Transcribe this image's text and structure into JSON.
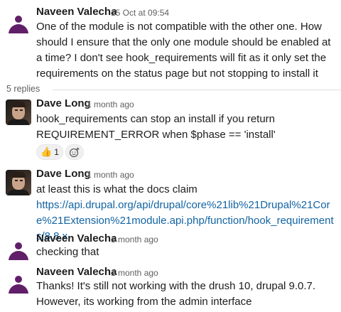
{
  "thread": {
    "replies_label": "5 replies",
    "messages": [
      {
        "author": "Naveen Valecha",
        "time": "15 Oct at 09:54",
        "text": "One of the module is not compatible with the other one. How should I ensure that the only one module should be enabled at a time? I don't see hook_requirements will fit as it only set the requirements on the status page but not stopping to install it"
      },
      {
        "author": "Dave Long",
        "time": "1 month ago",
        "text": "hook_requirements can stop an install if you return REQUIREMENT_ERROR when $phase == 'install'",
        "reaction": {
          "emoji": "👍",
          "count": "1"
        }
      },
      {
        "author": "Dave Long",
        "time": "1 month ago",
        "text_prefix": "at least this is what the docs claim",
        "link": "https://api.drupal.org/api/drupal/core%21lib%21Drupal%21Core%21Extension%21module.api.php/function/hook_requirements/8.8.x"
      },
      {
        "author": "Naveen Valecha",
        "time": "1 month ago",
        "text": "checking that"
      },
      {
        "author": "Naveen Valecha",
        "time": "1 month ago",
        "text": "Thanks! It's still not working with the drush 10, drupal 9.0.7. However, its working from the admin interface"
      }
    ]
  },
  "icons": {
    "avatar_default": "user-silhouette-icon",
    "add_reaction": "add-emoji-icon"
  },
  "colors": {
    "avatar": "#611f69",
    "link": "#1264a3",
    "muted": "#616061"
  }
}
